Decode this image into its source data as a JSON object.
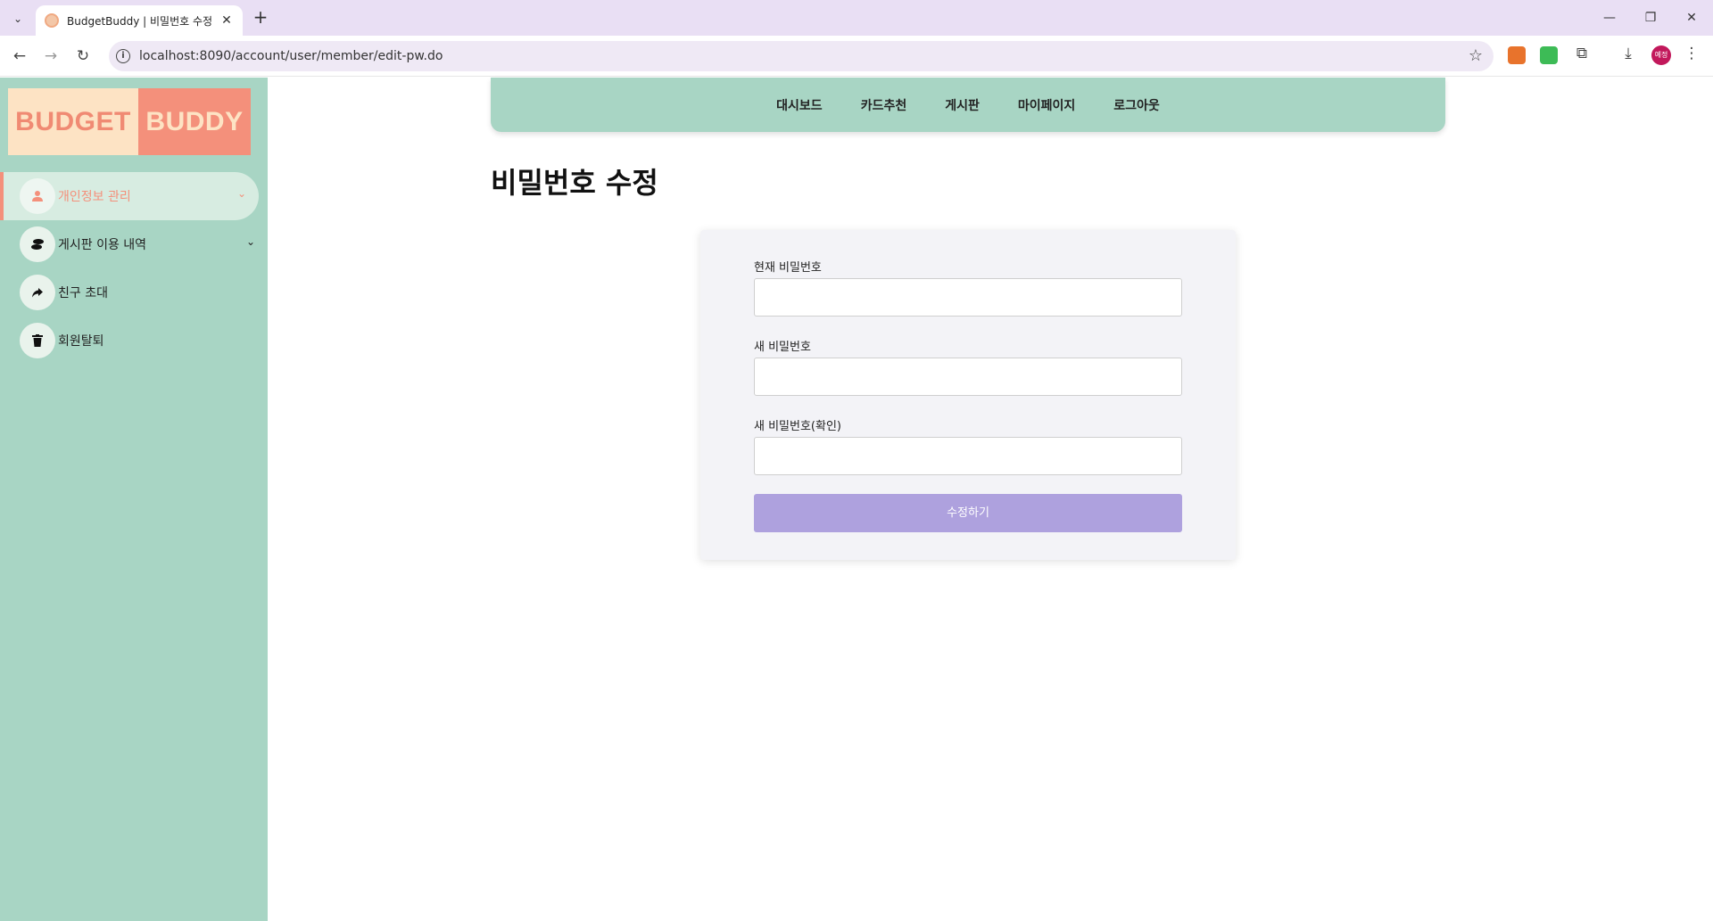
{
  "browser": {
    "tab_title": "BudgetBuddy | 비밀번호 수정",
    "url": "localhost:8090/account/user/member/edit-pw.do",
    "profile_initials": "예정"
  },
  "logo": {
    "left": "BUDGET",
    "right": "BUDDY"
  },
  "sidebar": {
    "items": [
      {
        "label": "개인정보 관리",
        "icon": "user-icon",
        "active": true,
        "has_chevron": true
      },
      {
        "label": "게시판 이용 내역",
        "icon": "board-icon",
        "active": false,
        "has_chevron": true
      },
      {
        "label": "친구 초대",
        "icon": "share-icon",
        "active": false,
        "has_chevron": false
      },
      {
        "label": "회원탈퇴",
        "icon": "trash-icon",
        "active": false,
        "has_chevron": false
      }
    ]
  },
  "topnav": [
    "대시보드",
    "카드추천",
    "게시판",
    "마이페이지",
    "로그아웃"
  ],
  "page": {
    "title": "비밀번호 수정"
  },
  "form": {
    "current_label": "현재 비밀번호",
    "current_value": "",
    "new_label": "새 비밀번호",
    "new_value": "",
    "confirm_label": "새 비밀번호(확인)",
    "confirm_value": "",
    "submit_label": "수정하기"
  },
  "colors": {
    "mint": "#a8d5c4",
    "coral": "#f4907b",
    "peach": "#fde3c4",
    "button_purple": "#aea1de"
  }
}
